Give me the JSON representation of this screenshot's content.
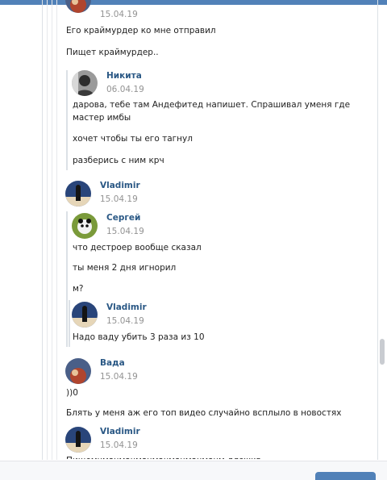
{
  "colors": {
    "accent": "#5181b8",
    "name": "#2a5885",
    "date": "#939393"
  },
  "messages": [
    {
      "date": "15.04.19",
      "avatar": "vada-avatar"
    },
    {
      "text": "Его краймурдер ко мне отправил"
    },
    {
      "text": "Пищет краймурдер.."
    }
  ],
  "quote_nikita": {
    "name": "Никита",
    "date": "06.04.19",
    "lines": [
      "дарова, тебе там Андефитед напишет. Спрашивал уменя где мастер имбы",
      "хочет чтобы ты его тагнул",
      "разберись с ним крч"
    ]
  },
  "vladimir_1": {
    "name": "Vladimir",
    "date": "15.04.19"
  },
  "quote_sergey": {
    "name": "Сергей",
    "date": "15.04.19",
    "lines": [
      "что дестроер вообще сказал",
      "ты меня 2 дня игнорил",
      "м?"
    ]
  },
  "quote_vladimir_inner": {
    "name": "Vladimir",
    "date": "15.04.19",
    "line": "Надо ваду убить 3 раза из 10"
  },
  "vada": {
    "name": "Вада",
    "date": "15.04.19",
    "lines": [
      "))0",
      "Блять у меня аж его топ видео случайно всплыло в новостях"
    ]
  },
  "vladimir_2": {
    "name": "Vladimir",
    "date": "15.04.19",
    "cut_line": "Пишемчмачмачмачмачмачмачмачм длсжкв"
  }
}
